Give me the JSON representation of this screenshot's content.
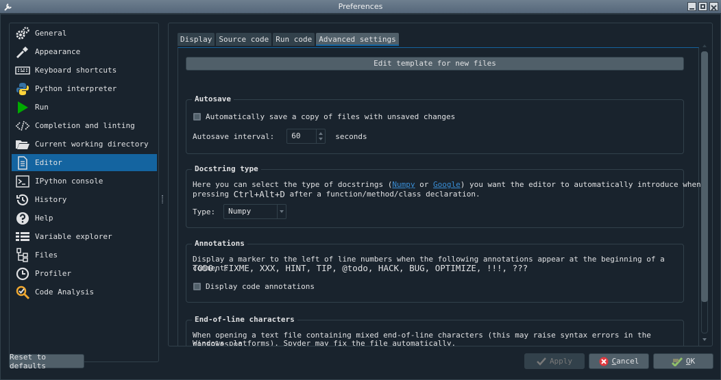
{
  "window": {
    "title": "Preferences"
  },
  "sidebar": {
    "items": [
      {
        "label": "General",
        "icon": "gears-icon"
      },
      {
        "label": "Appearance",
        "icon": "eyedropper-icon"
      },
      {
        "label": "Keyboard shortcuts",
        "icon": "keyboard-icon"
      },
      {
        "label": "Python interpreter",
        "icon": "python-icon"
      },
      {
        "label": "Run",
        "icon": "play-icon"
      },
      {
        "label": "Completion and linting",
        "icon": "code-icon"
      },
      {
        "label": "Current working directory",
        "icon": "folder-open-icon"
      },
      {
        "label": "Editor",
        "icon": "file-text-icon"
      },
      {
        "label": "IPython console",
        "icon": "terminal-icon"
      },
      {
        "label": "History",
        "icon": "history-icon"
      },
      {
        "label": "Help",
        "icon": "question-icon"
      },
      {
        "label": "Variable explorer",
        "icon": "table-icon"
      },
      {
        "label": "Files",
        "icon": "files-tree-icon"
      },
      {
        "label": "Profiler",
        "icon": "clock-icon"
      },
      {
        "label": "Code Analysis",
        "icon": "code-analysis-icon"
      }
    ],
    "active": "Editor"
  },
  "tabs": [
    "Display",
    "Source code",
    "Run code",
    "Advanced settings"
  ],
  "active_tab": "Advanced settings",
  "template_button": "Edit template for new files",
  "autosave": {
    "title": "Autosave",
    "checkbox_label": "Automatically save a copy of files with unsaved changes",
    "interval_label": "Autosave interval:",
    "interval_value": "60",
    "interval_unit": "seconds"
  },
  "docstring": {
    "title": "Docstring type",
    "text_1": "Here you can select the type of docstrings (",
    "link_numpy": "Numpy",
    "text_or": " or ",
    "link_google": "Google",
    "text_2": ") you want the editor to automatically introduce when",
    "text_3": "pressing ",
    "shortcut": "Ctrl+Alt+D",
    "text_4": " after a function/method/class declaration.",
    "type_label": "Type:",
    "type_value": "Numpy"
  },
  "annotations": {
    "title": "Annotations",
    "description": "Display a marker to the left of line numbers when the following annotations appear at the beginning of a comment:",
    "keywords": "TODO, FIXME, XXX, HINT, TIP, @todo, HACK, BUG, OPTIMIZE, !!!, ???",
    "checkbox_label": "Display code annotations"
  },
  "eol": {
    "title": "End-of-line characters",
    "line_1": "When opening a text file containing mixed end-of-line characters (this may raise syntax errors in the consoles on",
    "line_2": "Windows platforms), Spyder may fix the file automatically."
  },
  "buttons": {
    "reset": "Reset to defaults",
    "apply": "Apply",
    "cancel": "Cancel",
    "ok": "OK"
  }
}
